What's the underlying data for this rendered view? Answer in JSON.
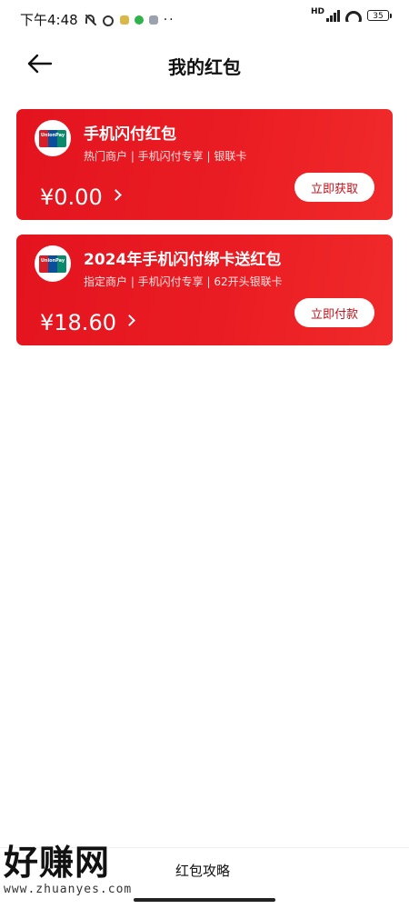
{
  "status_bar": {
    "time": "下午4:48",
    "battery": "35",
    "network": "HD"
  },
  "header": {
    "title": "我的红包"
  },
  "cards": [
    {
      "title": "手机闪付红包",
      "subtitle": "热门商户 | 手机闪付专享 | 银联卡",
      "amount": "¥0.00",
      "button": "立即获取",
      "logo_text": "UnionPay"
    },
    {
      "title": "2024年手机闪付绑卡送红包",
      "subtitle": "指定商户 | 手机闪付专享 | 62开头银联卡",
      "amount": "¥18.60",
      "button": "立即付款",
      "logo_text": "UnionPay"
    }
  ],
  "footer": {
    "link": "红包攻略",
    "watermark_big": "好赚网",
    "watermark_small": "www.zhuanyes.com"
  },
  "colors": {
    "card_red": "#e3141e",
    "button_text": "#c3121b"
  }
}
